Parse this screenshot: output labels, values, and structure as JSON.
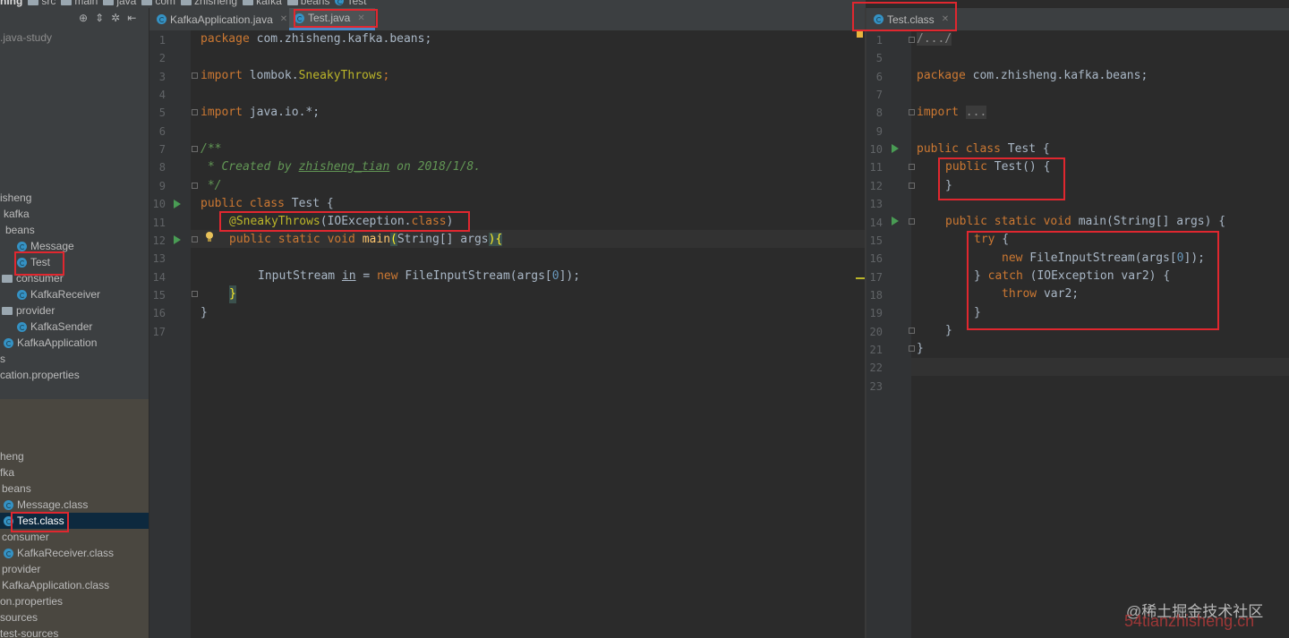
{
  "breadcrumb": [
    "hing",
    "src",
    "main",
    "java",
    "com",
    "zhisheng",
    "kafka",
    "beans",
    "Test"
  ],
  "project": {
    "root_label": ".java-study",
    "tree": [
      {
        "label": "isheng",
        "type": "folder"
      },
      {
        "label": "kafka",
        "type": "folder"
      },
      {
        "label": "beans",
        "type": "folder"
      },
      {
        "label": "Message",
        "type": "class"
      },
      {
        "label": "Test",
        "type": "class"
      },
      {
        "label": "consumer",
        "type": "folder"
      },
      {
        "label": "KafkaReceiver",
        "type": "class"
      },
      {
        "label": "provider",
        "type": "folder"
      },
      {
        "label": "KafkaSender",
        "type": "class"
      },
      {
        "label": "KafkaApplication",
        "type": "class"
      },
      {
        "label": "s",
        "type": "folder"
      },
      {
        "label": "cation.properties",
        "type": "file"
      }
    ],
    "output_tree": [
      {
        "label": "heng",
        "type": "folder"
      },
      {
        "label": "fka",
        "type": "folder"
      },
      {
        "label": "beans",
        "type": "folder"
      },
      {
        "label": "Message.class",
        "type": "class"
      },
      {
        "label": "Test.class",
        "type": "class",
        "selected": true
      },
      {
        "label": "consumer",
        "type": "folder"
      },
      {
        "label": "KafkaReceiver.class",
        "type": "class"
      },
      {
        "label": "provider",
        "type": "folder"
      },
      {
        "label": "KafkaApplication.class",
        "type": "class"
      },
      {
        "label": "on.properties",
        "type": "file"
      },
      {
        "label": "sources",
        "type": "folder"
      },
      {
        "label": "test-sources",
        "type": "folder"
      }
    ]
  },
  "tabs_left": [
    {
      "label": "KafkaApplication.java"
    },
    {
      "label": "Test.java",
      "active": true
    }
  ],
  "tab_right": {
    "label": "Test.class"
  },
  "left_code": {
    "line_numbers": [
      "1",
      "2",
      "3",
      "4",
      "5",
      "6",
      "7",
      "8",
      "9",
      "10",
      "11",
      "12",
      "13",
      "14",
      "15",
      "16",
      "17"
    ],
    "l1": [
      "package",
      " com.zhisheng.kafka.beans;"
    ],
    "l3": [
      "import",
      " lombok.",
      "SneakyThrows",
      ";"
    ],
    "l5": [
      "import",
      " java.io.*;"
    ],
    "l7": "/**",
    "l8": [
      " * Created by ",
      "zhisheng_tian",
      " on 2018/1/8."
    ],
    "l9": " */",
    "l10": [
      "public class",
      " Test {"
    ],
    "l11": [
      "@SneakyThrows",
      "(IOException.",
      "class",
      ")"
    ],
    "l12": [
      "public static void",
      " ",
      "main",
      "(",
      "String[] args",
      ")",
      "{"
    ],
    "l14": [
      "InputStream ",
      "in",
      " = ",
      "new",
      " FileInputStream(args[",
      "0",
      "]);"
    ],
    "l15": "}",
    "l16": "}"
  },
  "right_code": {
    "line_numbers": [
      "1",
      "5",
      "6",
      "7",
      "8",
      "9",
      "10",
      "11",
      "12",
      "13",
      "14",
      "15",
      "16",
      "17",
      "18",
      "19",
      "20",
      "21",
      "22",
      "23"
    ],
    "l1": "/.../",
    "l6": [
      "package",
      " com.zhisheng.kafka.beans;"
    ],
    "l8": [
      "import",
      " ",
      "..."
    ],
    "l11": [
      "public class",
      " Test {"
    ],
    "l12": [
      "public",
      " Test() {"
    ],
    "l13": "}",
    "l15": [
      "public static void",
      " main(String[] args) {"
    ],
    "l16": [
      "try",
      " {"
    ],
    "l17": [
      "new",
      " FileInputStream(args[",
      "0",
      "]);"
    ],
    "l18": [
      "} ",
      "catch",
      " (IOException var2) {"
    ],
    "l19": [
      "throw",
      " var2;"
    ],
    "l20": "}",
    "l21": "}",
    "l22": "}"
  },
  "watermark": "@稀土掘金技术社区",
  "watermark2": "54tianzhisheng.cn",
  "colors": {
    "highlight_box": "#e0272f",
    "keyword": "#cc7832",
    "annotation": "#bbb529",
    "doc_comment": "#629755",
    "number": "#6897bb"
  }
}
